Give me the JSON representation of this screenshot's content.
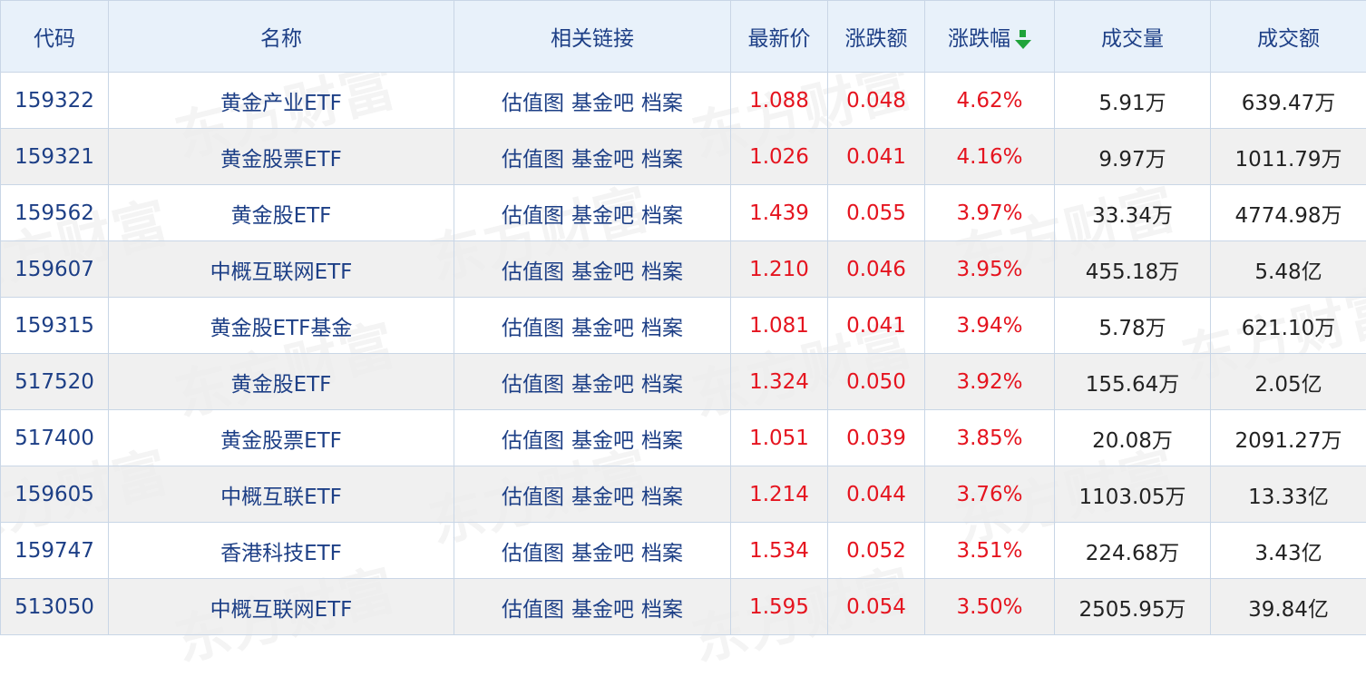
{
  "table": {
    "headers": {
      "code": "代码",
      "name": "名称",
      "links": "相关链接",
      "price": "最新价",
      "change": "涨跌额",
      "change_pct": "涨跌幅",
      "volume": "成交量",
      "turnover": "成交额"
    },
    "sort_icon": "arrow-down-icon",
    "accent_colors": {
      "up": "#e5141f",
      "link": "#1d3f86",
      "sort": "#1fa33a",
      "header_bg": "#e8f1fa"
    },
    "rows": [
      {
        "code": "159322",
        "name": "黄金产业ETF",
        "links": [
          "估值图",
          "基金吧",
          "档案"
        ],
        "price": "1.088",
        "change": "0.048",
        "change_pct": "4.62%",
        "volume": "5.91万",
        "turnover": "639.47万"
      },
      {
        "code": "159321",
        "name": "黄金股票ETF",
        "links": [
          "估值图",
          "基金吧",
          "档案"
        ],
        "price": "1.026",
        "change": "0.041",
        "change_pct": "4.16%",
        "volume": "9.97万",
        "turnover": "1011.79万"
      },
      {
        "code": "159562",
        "name": "黄金股ETF",
        "links": [
          "估值图",
          "基金吧",
          "档案"
        ],
        "price": "1.439",
        "change": "0.055",
        "change_pct": "3.97%",
        "volume": "33.34万",
        "turnover": "4774.98万"
      },
      {
        "code": "159607",
        "name": "中概互联网ETF",
        "links": [
          "估值图",
          "基金吧",
          "档案"
        ],
        "price": "1.210",
        "change": "0.046",
        "change_pct": "3.95%",
        "volume": "455.18万",
        "turnover": "5.48亿"
      },
      {
        "code": "159315",
        "name": "黄金股ETF基金",
        "links": [
          "估值图",
          "基金吧",
          "档案"
        ],
        "price": "1.081",
        "change": "0.041",
        "change_pct": "3.94%",
        "volume": "5.78万",
        "turnover": "621.10万"
      },
      {
        "code": "517520",
        "name": "黄金股ETF",
        "links": [
          "估值图",
          "基金吧",
          "档案"
        ],
        "price": "1.324",
        "change": "0.050",
        "change_pct": "3.92%",
        "volume": "155.64万",
        "turnover": "2.05亿"
      },
      {
        "code": "517400",
        "name": "黄金股票ETF",
        "links": [
          "估值图",
          "基金吧",
          "档案"
        ],
        "price": "1.051",
        "change": "0.039",
        "change_pct": "3.85%",
        "volume": "20.08万",
        "turnover": "2091.27万"
      },
      {
        "code": "159605",
        "name": "中概互联ETF",
        "links": [
          "估值图",
          "基金吧",
          "档案"
        ],
        "price": "1.214",
        "change": "0.044",
        "change_pct": "3.76%",
        "volume": "1103.05万",
        "turnover": "13.33亿"
      },
      {
        "code": "159747",
        "name": "香港科技ETF",
        "links": [
          "估值图",
          "基金吧",
          "档案"
        ],
        "price": "1.534",
        "change": "0.052",
        "change_pct": "3.51%",
        "volume": "224.68万",
        "turnover": "3.43亿"
      },
      {
        "code": "513050",
        "name": "中概互联网ETF",
        "links": [
          "估值图",
          "基金吧",
          "档案"
        ],
        "price": "1.595",
        "change": "0.054",
        "change_pct": "3.50%",
        "volume": "2505.95万",
        "turnover": "39.84亿"
      }
    ]
  },
  "watermark": "东方财富"
}
